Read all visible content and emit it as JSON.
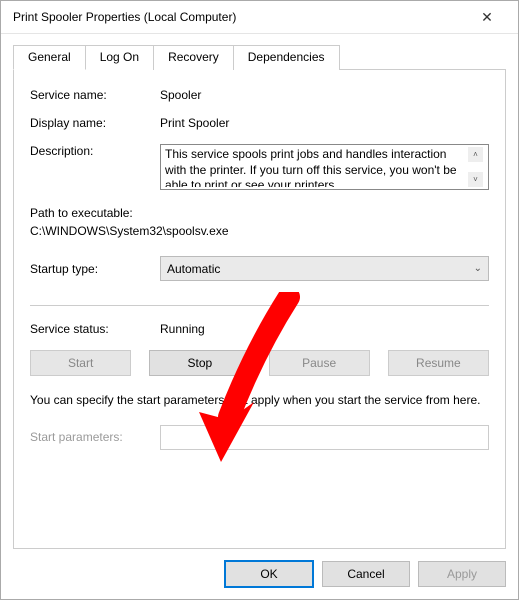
{
  "window": {
    "title": "Print Spooler Properties (Local Computer)"
  },
  "tabs": {
    "general": "General",
    "logon": "Log On",
    "recovery": "Recovery",
    "dependencies": "Dependencies"
  },
  "labels": {
    "service_name": "Service name:",
    "display_name": "Display name:",
    "description": "Description:",
    "path_to_exe": "Path to executable:",
    "startup_type": "Startup type:",
    "service_status": "Service status:",
    "start_parameters": "Start parameters:"
  },
  "values": {
    "service_name": "Spooler",
    "display_name": "Print Spooler",
    "description": "This service spools print jobs and handles interaction with the printer.  If you turn off this service, you won't be able to print or see your printers.",
    "path": "C:\\WINDOWS\\System32\\spoolsv.exe",
    "startup_type": "Automatic",
    "service_status": "Running"
  },
  "buttons": {
    "start": "Start",
    "stop": "Stop",
    "pause": "Pause",
    "resume": "Resume",
    "ok": "OK",
    "cancel": "Cancel",
    "apply": "Apply"
  },
  "note": "You can specify the start parameters that apply when you start the service from here."
}
